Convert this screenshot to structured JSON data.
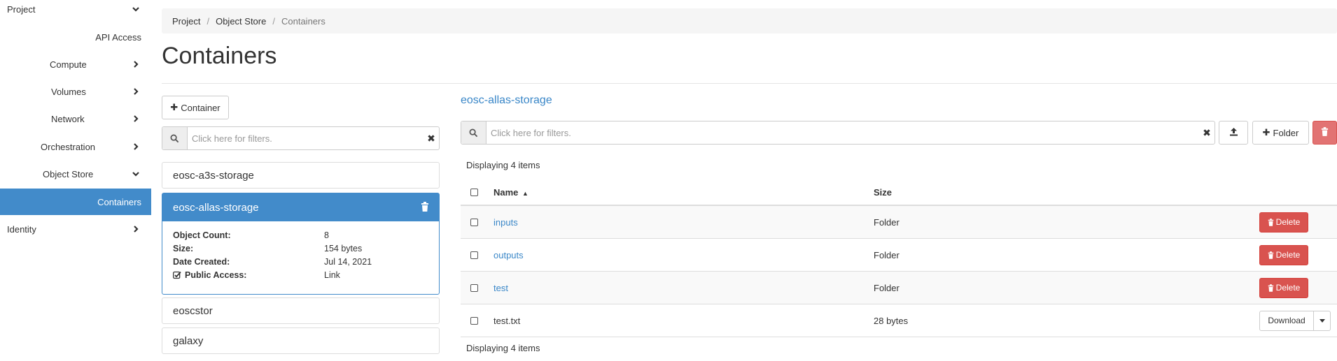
{
  "sidebar": {
    "project": "Project",
    "api_access": "API Access",
    "compute": "Compute",
    "volumes": "Volumes",
    "network": "Network",
    "orchestration": "Orchestration",
    "object_store": "Object Store",
    "containers": "Containers",
    "identity": "Identity"
  },
  "breadcrumb": [
    "Project",
    "Object Store",
    "Containers"
  ],
  "page_title": "Containers",
  "left": {
    "add_container_label": "Container",
    "filter_placeholder": "Click here for filters.",
    "containers": [
      {
        "name": "eosc-a3s-storage"
      },
      {
        "name": "eosc-allas-storage"
      },
      {
        "name": "eoscstor"
      },
      {
        "name": "galaxy"
      }
    ],
    "selected_details": {
      "object_count_label": "Object Count:",
      "object_count": "8",
      "size_label": "Size:",
      "size": "154 bytes",
      "date_label": "Date Created:",
      "date": "Jul 14, 2021",
      "public_label": "Public Access:",
      "public_value": "Link"
    }
  },
  "right": {
    "container_title": "eosc-allas-storage",
    "filter_placeholder": "Click here for filters.",
    "folder_label": "Folder",
    "displaying": "Displaying 4 items",
    "columns": {
      "name": "Name",
      "size": "Size"
    },
    "rows": [
      {
        "name": "inputs",
        "size": "Folder",
        "action": "Delete"
      },
      {
        "name": "outputs",
        "size": "Folder",
        "action": "Delete"
      },
      {
        "name": "test",
        "size": "Folder",
        "action": "Delete"
      },
      {
        "name": "test.txt",
        "size": "28 bytes",
        "action": "Download"
      }
    ]
  },
  "colors": {
    "primary": "#428bca",
    "danger": "#d9534f",
    "link": "#3a87c8"
  }
}
